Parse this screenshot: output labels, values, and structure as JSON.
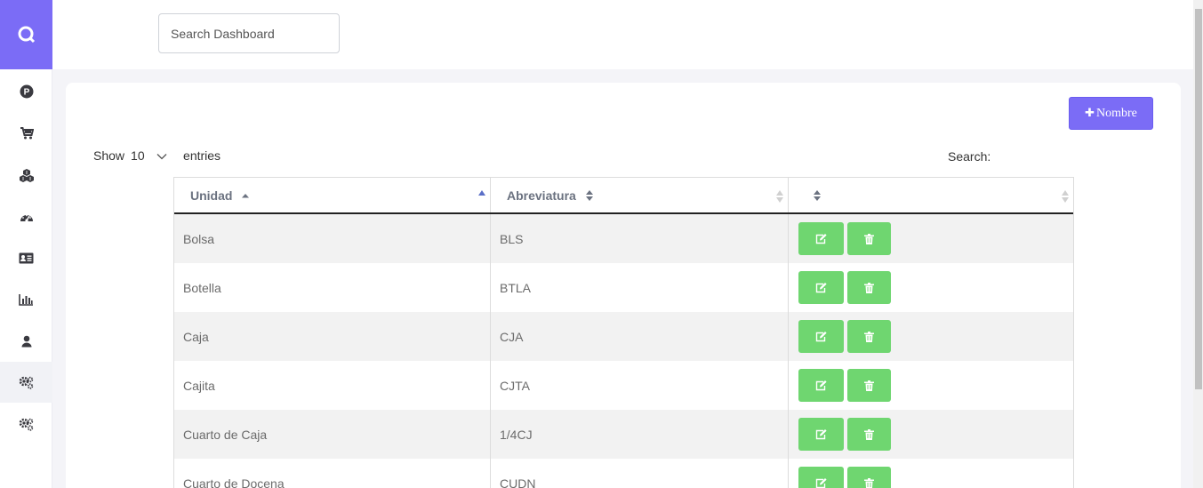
{
  "sidebar": {
    "logo_icon": "search-logo-icon",
    "items": [
      {
        "icon": "p-circle-icon"
      },
      {
        "icon": "cart-icon"
      },
      {
        "icon": "boxes-icon"
      },
      {
        "icon": "dashboard-gauge-icon"
      },
      {
        "icon": "id-card-icon"
      },
      {
        "icon": "bar-chart-icon"
      },
      {
        "icon": "user-icon"
      },
      {
        "icon": "cogs-icon",
        "active": true
      },
      {
        "icon": "cogs-icon"
      }
    ]
  },
  "header": {
    "search_placeholder": "Search Dashboard"
  },
  "card": {
    "add_button_label": "Nombre",
    "show_label": "Show",
    "entries_value": "10",
    "entries_label": "entries",
    "search_label": "Search:"
  },
  "table": {
    "columns": [
      "Unidad",
      "Abreviatura",
      ""
    ],
    "rows": [
      {
        "unidad": "Bolsa",
        "abreviatura": "BLS"
      },
      {
        "unidad": "Botella",
        "abreviatura": "BTLA"
      },
      {
        "unidad": "Caja",
        "abreviatura": "CJA"
      },
      {
        "unidad": "Cajita",
        "abreviatura": "CJTA"
      },
      {
        "unidad": "Cuarto de Caja",
        "abreviatura": "1/4CJ"
      },
      {
        "unidad": "Cuarto de Docena",
        "abreviatura": "CUDN"
      }
    ]
  },
  "colors": {
    "accent": "#7b6cf6",
    "action_green": "#6fd670"
  }
}
